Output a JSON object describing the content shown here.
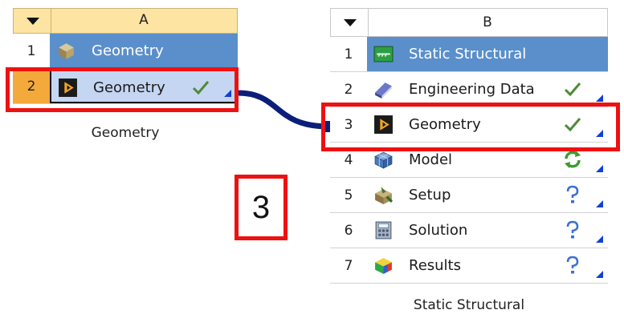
{
  "system_a": {
    "column_letter": "A",
    "rows": [
      {
        "num": "1",
        "label": "Geometry",
        "icon": "geometry-cube-icon",
        "status": ""
      },
      {
        "num": "2",
        "label": "Geometry",
        "icon": "geometry-play-icon",
        "status": "check-icon"
      }
    ],
    "caption": "Geometry"
  },
  "system_b": {
    "column_letter": "B",
    "rows": [
      {
        "num": "1",
        "label": "Static Structural",
        "icon": "static-structural-icon",
        "status": ""
      },
      {
        "num": "2",
        "label": "Engineering Data",
        "icon": "engineering-data-icon",
        "status": "check-icon"
      },
      {
        "num": "3",
        "label": "Geometry",
        "icon": "geometry-play-icon",
        "status": "check-icon"
      },
      {
        "num": "4",
        "label": "Model",
        "icon": "model-mesh-icon",
        "status": "refresh-icon"
      },
      {
        "num": "5",
        "label": "Setup",
        "icon": "setup-icon",
        "status": "question-icon"
      },
      {
        "num": "6",
        "label": "Solution",
        "icon": "solution-icon",
        "status": "question-icon"
      },
      {
        "num": "7",
        "label": "Results",
        "icon": "results-icon",
        "status": "question-icon"
      }
    ],
    "caption": "Static Structural"
  },
  "annotation": {
    "step_number": "3"
  },
  "colors": {
    "highlight_red": "#ee1111",
    "header_blue": "#5a8fcb",
    "selected_row": "#c5d6f2",
    "orange": "#f4a93b",
    "link_navy": "#0b1f7a"
  }
}
